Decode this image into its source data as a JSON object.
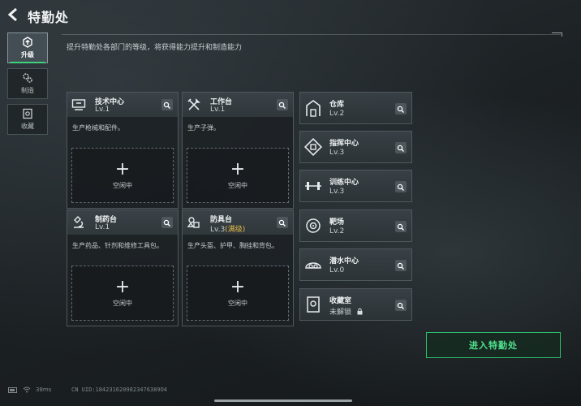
{
  "header": {
    "title": "特勤处",
    "subtitle": "提升特勤处各部门的等级，将获得能力提升和制造能力"
  },
  "tabs": [
    {
      "label": "升级",
      "icon": "upgrade-icon",
      "active": true
    },
    {
      "label": "制造",
      "icon": "gears-icon",
      "active": false
    },
    {
      "label": "收藏",
      "icon": "collection-icon",
      "active": false
    }
  ],
  "departments": [
    {
      "name": "技术中心",
      "level": "Lv.1",
      "desc": "生产枪械和配件。",
      "slot_plus": "+",
      "slot_status": "空闲中",
      "icon": "computer-icon"
    },
    {
      "name": "工作台",
      "level": "Lv.1",
      "desc": "生产子弹。",
      "slot_plus": "+",
      "slot_status": "空闲中",
      "icon": "tools-icon"
    },
    {
      "name": "制药台",
      "level": "Lv.1",
      "desc": "生产药品、针剂和维修工具包。",
      "slot_plus": "+",
      "slot_status": "空闲中",
      "icon": "microscope-icon"
    },
    {
      "name": "防具台",
      "level": "Lv.3",
      "level_max": "(满级)",
      "desc": "生产头盔、护甲、胸挂和背包。",
      "slot_plus": "+",
      "slot_status": "空闲中",
      "icon": "armor-icon"
    }
  ],
  "facilities": [
    {
      "name": "仓库",
      "level": "Lv.2",
      "icon": "warehouse-icon"
    },
    {
      "name": "指挥中心",
      "level": "Lv.3",
      "icon": "command-icon"
    },
    {
      "name": "训练中心",
      "level": "Lv.3",
      "icon": "dumbbell-icon"
    },
    {
      "name": "靶场",
      "level": "Lv.2",
      "icon": "target-icon"
    },
    {
      "name": "潜水中心",
      "level": "Lv.0",
      "icon": "diving-icon"
    },
    {
      "name": "收藏室",
      "level": "未解锁",
      "icon": "vault-icon",
      "locked": true
    }
  ],
  "enter_button": "进入特勤处",
  "status": {
    "ping": "38ms"
  },
  "uid": "CN UID:1842316209823476389O4",
  "colors": {
    "accent_green": "#3fd17d",
    "max_level": "#e2b84a"
  }
}
